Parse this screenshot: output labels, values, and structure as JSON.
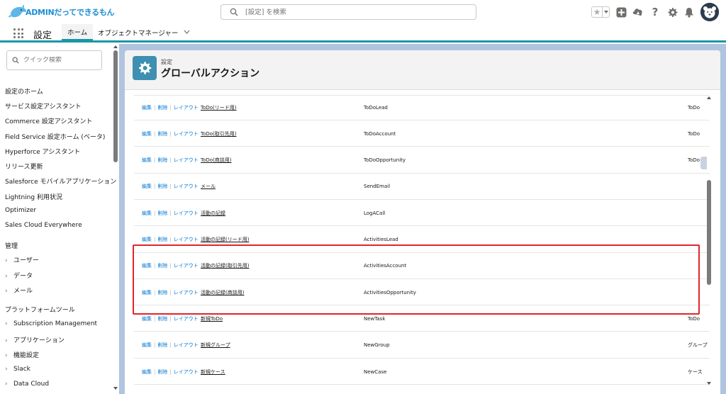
{
  "header": {
    "logo_text": "ADMINだってできるもん",
    "search_placeholder": "[設定] を検索"
  },
  "top_icons": [
    "star-icon",
    "chevron-down-icon",
    "add-icon",
    "trailhead-icon",
    "help-icon",
    "gear-icon",
    "bell-icon",
    "avatar"
  ],
  "nav": {
    "app_name": "設定",
    "tab_home": "ホーム",
    "tab_object_manager": "オブジェクトマネージャー"
  },
  "sidebar": {
    "quick_find_placeholder": "クイック検索",
    "items": [
      {
        "label": "設定のホーム"
      },
      {
        "label": "サービス設定アシスタント"
      },
      {
        "label": "Commerce 設定アシスタント"
      },
      {
        "label": "Field Service 設定ホーム (ベータ)"
      },
      {
        "label": "Hyperforce アシスタント"
      },
      {
        "label": "リリース更新"
      },
      {
        "label": "Salesforce モバイルアプリケーション"
      },
      {
        "label": "Lightning 利用状況"
      },
      {
        "label": "Optimizer"
      },
      {
        "label": "Sales Cloud Everywhere"
      }
    ],
    "section_admin": "管理",
    "admin_items": [
      {
        "label": "ユーザー"
      },
      {
        "label": "データ"
      },
      {
        "label": "メール"
      }
    ],
    "section_platform": "プラットフォームツール",
    "platform_items": [
      {
        "label": "Subscription Management"
      },
      {
        "label": "アプリケーション"
      },
      {
        "label": "機能設定"
      },
      {
        "label": "Slack"
      },
      {
        "label": "Data Cloud"
      }
    ]
  },
  "page": {
    "eyebrow": "設定",
    "title": "グローバルアクション"
  },
  "row_actions": {
    "edit": "編集",
    "delete": "削除",
    "layout": "レイアウト",
    "sep": "|"
  },
  "rows": [
    {
      "label": "ToDo(リード用)",
      "api_name": "ToDoLead",
      "target": "ToDo"
    },
    {
      "label": "ToDo(取引先用)",
      "api_name": "ToDoAccount",
      "target": "ToDo"
    },
    {
      "label": "ToDo(商談用)",
      "api_name": "ToDoOpportunity",
      "target": "ToDo"
    },
    {
      "label": "メール",
      "api_name": "SendEmail",
      "target": ""
    },
    {
      "label": "活動の記録",
      "api_name": "LogACall",
      "target": ""
    },
    {
      "label": "活動の記録(リード用)",
      "api_name": "ActivitiesLead",
      "target": ""
    },
    {
      "label": "活動の記録(取引先用)",
      "api_name": "ActivitiesAccount",
      "target": ""
    },
    {
      "label": "活動の記録(商談用)",
      "api_name": "ActivitiesOpportunity",
      "target": ""
    },
    {
      "label": "新規ToDo",
      "api_name": "NewTask",
      "target": "ToDo"
    },
    {
      "label": "新規グループ",
      "api_name": "NewGroup",
      "target": "グループ"
    },
    {
      "label": "新規ケース",
      "api_name": "NewCase",
      "target": "ケース"
    }
  ],
  "colors": {
    "accent": "#1b96a7",
    "link": "#0176d3",
    "highlight": "#e0252b",
    "page_bg": "#b0c4df"
  }
}
